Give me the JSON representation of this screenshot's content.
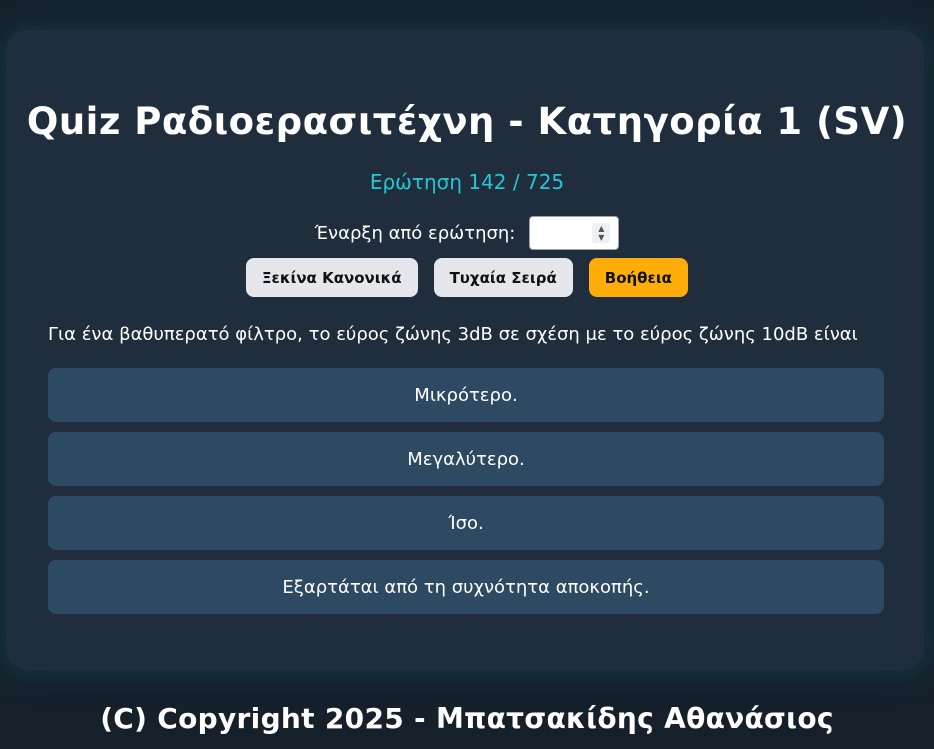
{
  "header": {
    "title": "Quiz Ραδιοερασιτέχνη - Κατηγορία 1 (SV)",
    "counter": "Ερώτηση 142 / 725"
  },
  "start": {
    "label": "Έναρξη από ερώτηση:",
    "value": ""
  },
  "buttons": {
    "normal": "Ξεκίνα Κανονικά",
    "random": "Τυχαία Σειρά",
    "help": "Βοήθεια"
  },
  "question": "Για ένα βαθυπερατό φίλτρο, το εύρος ζώνης 3dB σε σχέση με το εύρος ζώνης 10dB είναι",
  "answers": [
    "Μικρότερο.",
    "Μεγαλύτερο.",
    "Ίσο.",
    "Εξαρτάται από τη συχνότητα αποκοπής."
  ],
  "footer": "(C) Copyright 2025 - Μπατσακίδης Αθανάσιος",
  "colors": {
    "accent": "#22c8d6",
    "help_button": "#ffad08",
    "answer_bg": "#2e4962",
    "card_bg": "#1f2d3d",
    "page_bg": "#15202b"
  }
}
